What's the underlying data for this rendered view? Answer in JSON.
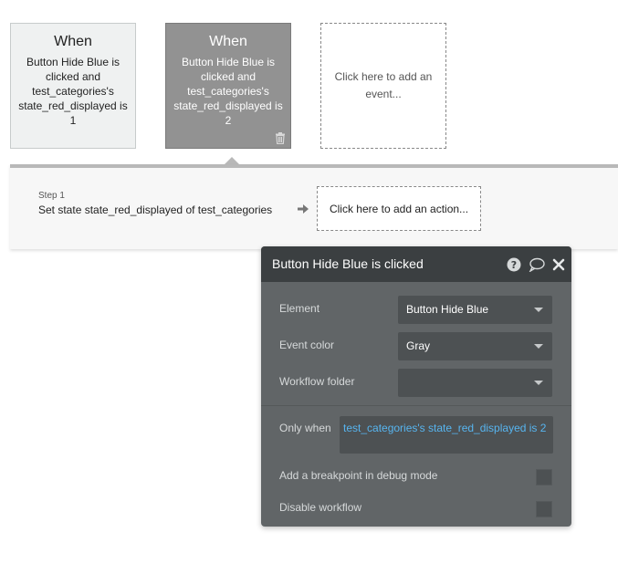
{
  "events": [
    {
      "when": "When",
      "description": "Button Hide Blue is clicked and test_categories's state_red_displayed is 1"
    },
    {
      "when": "When",
      "description": "Button Hide Blue is clicked and test_categories's state_red_displayed is 2"
    }
  ],
  "add_event_text": "Click here to add an event...",
  "step": {
    "label": "Step 1",
    "text": "Set state state_red_displayed of test_categories"
  },
  "add_action_text": "Click here to add an action...",
  "panel": {
    "title": "Button Hide Blue is clicked",
    "element_label": "Element",
    "element_value": "Button Hide Blue",
    "event_color_label": "Event color",
    "event_color_value": "Gray",
    "workflow_folder_label": "Workflow folder",
    "workflow_folder_value": "",
    "only_when_label": "Only when",
    "only_when_value": "test_categories's state_red_displayed is 2",
    "breakpoint_label": "Add a breakpoint in debug mode",
    "disable_label": "Disable workflow"
  },
  "icons": {
    "trash": "trash-icon",
    "arrow": "arrow-right-icon",
    "help": "help-icon",
    "comment": "comment-icon",
    "close": "close-icon"
  },
  "colors": {
    "selected_event": "#929292",
    "panel_bg": "#616567",
    "panel_header": "#3b3f41",
    "link_blue": "#57b5f0"
  }
}
